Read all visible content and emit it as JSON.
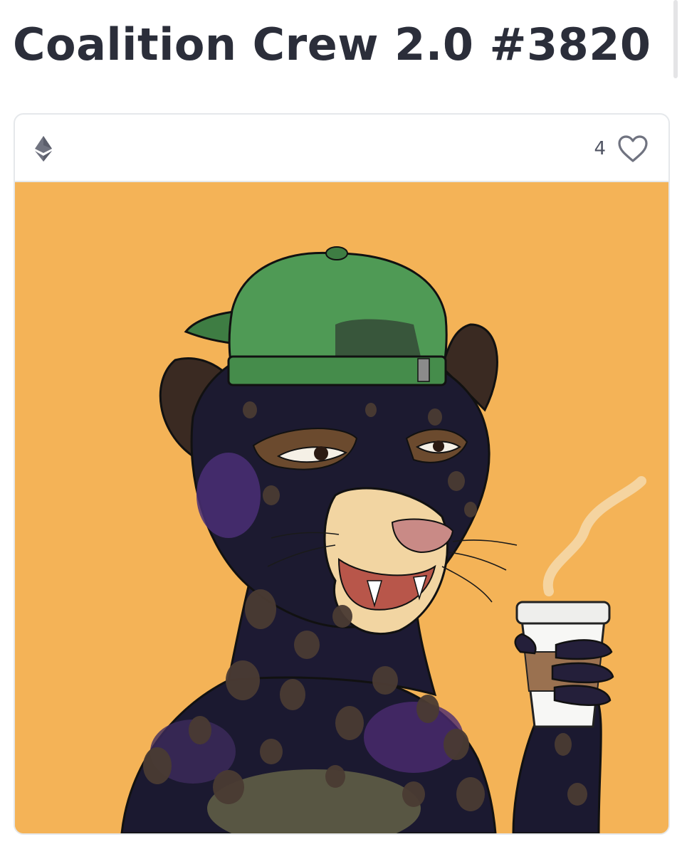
{
  "title": "Coalition Crew 2.0 #3820",
  "card": {
    "chain_icon": "ethereum-icon",
    "like_count": "4",
    "like_icon": "heart-outline-icon"
  },
  "artwork": {
    "subject": "jaguar wearing backwards green cap holding coffee cup",
    "background_color": "#F4B357"
  },
  "colors": {
    "title": "#2B2E3A",
    "border": "#E5E8EB",
    "icon": "#707380"
  }
}
